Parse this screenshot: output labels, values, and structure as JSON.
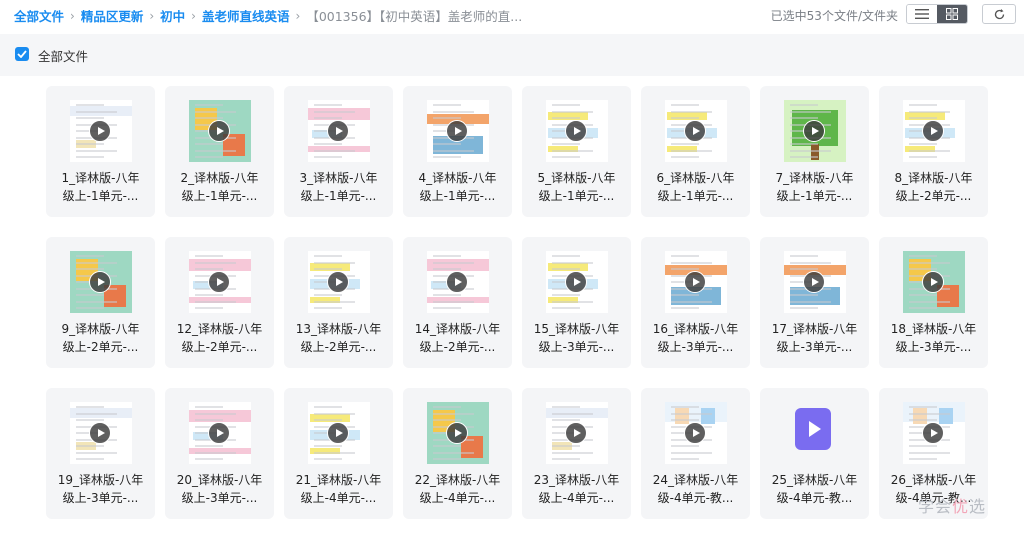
{
  "breadcrumb": {
    "items": [
      "全部文件",
      "精品区更新",
      "初中",
      "盖老师直线英语"
    ],
    "current": "【001356】【初中英语】盖老师的直..."
  },
  "selection_info": "已选中53个文件/文件夹",
  "select_all_label": "全部文件",
  "files": [
    {
      "line1": "1_译林版-八年",
      "line2": "级上-1单元-...",
      "thumb": "page"
    },
    {
      "line1": "2_译林版-八年",
      "line2": "级上-1单元-...",
      "thumb": "cartoon"
    },
    {
      "line1": "3_译林版-八年",
      "line2": "级上-1单元-...",
      "thumb": "page-pink"
    },
    {
      "line1": "4_译林版-八年",
      "line2": "级上-1单元-...",
      "thumb": "page-photo"
    },
    {
      "line1": "5_译林版-八年",
      "line2": "级上-1单元-...",
      "thumb": "page-yellow"
    },
    {
      "line1": "6_译林版-八年",
      "line2": "级上-1单元-...",
      "thumb": "page-yellow"
    },
    {
      "line1": "7_译林版-八年",
      "line2": "级上-1单元-...",
      "thumb": "tree"
    },
    {
      "line1": "8_译林版-八年",
      "line2": "级上-2单元-...",
      "thumb": "page-yellow"
    },
    {
      "line1": "9_译林版-八年",
      "line2": "级上-2单元-...",
      "thumb": "cartoon"
    },
    {
      "line1": "12_译林版-八年",
      "line2": "级上-2单元-...",
      "thumb": "page-pink"
    },
    {
      "line1": "13_译林版-八年",
      "line2": "级上-2单元-...",
      "thumb": "page-yellow"
    },
    {
      "line1": "14_译林版-八年",
      "line2": "级上-2单元-...",
      "thumb": "page-pink"
    },
    {
      "line1": "15_译林版-八年",
      "line2": "级上-3单元-...",
      "thumb": "page-yellow"
    },
    {
      "line1": "16_译林版-八年",
      "line2": "级上-3单元-...",
      "thumb": "page-photo"
    },
    {
      "line1": "17_译林版-八年",
      "line2": "级上-3单元-...",
      "thumb": "page-photo"
    },
    {
      "line1": "18_译林版-八年",
      "line2": "级上-3单元-...",
      "thumb": "cartoon"
    },
    {
      "line1": "19_译林版-八年",
      "line2": "级上-3单元-...",
      "thumb": "page"
    },
    {
      "line1": "20_译林版-八年",
      "line2": "级上-3单元-...",
      "thumb": "page-pink"
    },
    {
      "line1": "21_译林版-八年",
      "line2": "级上-4单元-...",
      "thumb": "page-yellow"
    },
    {
      "line1": "22_译林版-八年",
      "line2": "级上-4单元-...",
      "thumb": "cartoon"
    },
    {
      "line1": "23_译林版-八年",
      "line2": "级上-4单元-...",
      "thumb": "page"
    },
    {
      "line1": "24_译林版-八年",
      "line2": "级-4单元-教...",
      "thumb": "people"
    },
    {
      "line1": "25_译林版-八年",
      "line2": "级-4单元-教...",
      "thumb": "video-icon"
    },
    {
      "line1": "26_译林版-八年",
      "line2": "级-4单元-教...",
      "thumb": "people"
    }
  ],
  "watermark": {
    "part1": "学会",
    "part2": "优",
    "part3": "选"
  },
  "colors": {
    "accent": "#1a8cf0",
    "card_bg": "#f4f5f7",
    "video_icon": "#7a6cf0"
  }
}
